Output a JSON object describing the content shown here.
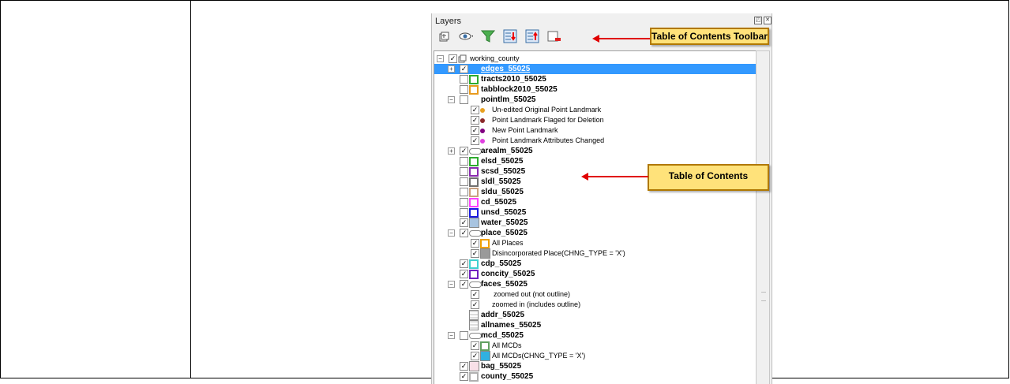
{
  "panel": {
    "title": "Layers"
  },
  "toolbar_icons": [
    "add-group-icon",
    "manage-visibility-icon",
    "filter-legend-icon",
    "expand-all-icon",
    "collapse-all-icon",
    "remove-layer-icon"
  ],
  "callouts": {
    "toolbar": "Table of Contents Toolbar",
    "toc": "Table of Contents"
  },
  "tree": [
    {
      "label": "working_county",
      "bold": false,
      "indent": 0,
      "checked": true,
      "expander": "-",
      "sym": "group"
    },
    {
      "label": "edges_55025",
      "bold": true,
      "indent": 1,
      "checked": true,
      "expander": "+",
      "sym": "none",
      "selected": true
    },
    {
      "label": "tracts2010_55025",
      "bold": true,
      "indent": 1,
      "checked": false,
      "sym": "sq",
      "color": "#2eab2e"
    },
    {
      "label": "tabblock2010_55025",
      "bold": true,
      "indent": 1,
      "checked": false,
      "sym": "sq",
      "color": "#e89a1e"
    },
    {
      "label": "pointlm_55025",
      "bold": true,
      "indent": 1,
      "checked": false,
      "expander": "-",
      "sym": "none"
    },
    {
      "label": "Un-edited Original Point Landmark",
      "bold": false,
      "indent": 2,
      "checked": true,
      "sym": "dot",
      "color": "#e8a020"
    },
    {
      "label": "Point Landmark Flaged for Deletion",
      "bold": false,
      "indent": 2,
      "checked": true,
      "sym": "dot",
      "color": "#8b2a2a"
    },
    {
      "label": "New Point Landmark",
      "bold": false,
      "indent": 2,
      "checked": true,
      "sym": "dot",
      "color": "#800080"
    },
    {
      "label": "Point Landmark Attributes Changed",
      "bold": false,
      "indent": 2,
      "checked": true,
      "sym": "dot",
      "color": "#e040e0"
    },
    {
      "label": "arealm_55025",
      "bold": true,
      "indent": 1,
      "checked": true,
      "expander": "+",
      "sym": "cloud"
    },
    {
      "label": "elsd_55025",
      "bold": true,
      "indent": 1,
      "checked": false,
      "sym": "sq",
      "color": "#2eab2e"
    },
    {
      "label": "scsd_55025",
      "bold": true,
      "indent": 1,
      "checked": false,
      "sym": "sq",
      "color": "#8a2ab0"
    },
    {
      "label": "sldl_55025",
      "bold": true,
      "indent": 1,
      "checked": false,
      "sym": "sq",
      "color": "#707070"
    },
    {
      "label": "sldu_55025",
      "bold": true,
      "indent": 1,
      "checked": false,
      "sym": "sq",
      "color": "#c8a080"
    },
    {
      "label": "cd_55025",
      "bold": true,
      "indent": 1,
      "checked": false,
      "sym": "sq",
      "color": "#ff40ff"
    },
    {
      "label": "unsd_55025",
      "bold": true,
      "indent": 1,
      "checked": false,
      "sym": "sq",
      "color": "#1a1ae0"
    },
    {
      "label": "water_55025",
      "bold": true,
      "indent": 1,
      "checked": true,
      "sym": "fill",
      "color": "#a8c4e0"
    },
    {
      "label": "place_55025",
      "bold": true,
      "indent": 1,
      "checked": true,
      "expander": "-",
      "sym": "cloud"
    },
    {
      "label": "All Places",
      "bold": false,
      "indent": 2,
      "checked": true,
      "sym": "sq",
      "color": "#f0a000"
    },
    {
      "label": "Disincorporated Place(CHNG_TYPE = 'X')",
      "bold": false,
      "indent": 2,
      "checked": true,
      "sym": "fill",
      "color": "#9a9a9a"
    },
    {
      "label": "cdp_55025",
      "bold": true,
      "indent": 1,
      "checked": true,
      "sym": "sq",
      "color": "#40d0d0"
    },
    {
      "label": "concity_55025",
      "bold": true,
      "indent": 1,
      "checked": true,
      "sym": "sq",
      "color": "#7020c0"
    },
    {
      "label": "faces_55025",
      "bold": true,
      "indent": 1,
      "checked": true,
      "expander": "-",
      "sym": "cloud"
    },
    {
      "label": "zoomed out (not outline)",
      "bold": false,
      "indent": 2,
      "checked": true,
      "sym": "none"
    },
    {
      "label": "zoomed in (includes outline)",
      "bold": false,
      "indent": 2,
      "checked": true,
      "sym": "blank"
    },
    {
      "label": "addr_55025",
      "bold": true,
      "indent": 1,
      "checked": null,
      "sym": "table"
    },
    {
      "label": "allnames_55025",
      "bold": true,
      "indent": 1,
      "checked": null,
      "sym": "table"
    },
    {
      "label": "mcd_55025",
      "bold": true,
      "indent": 1,
      "checked": false,
      "expander": "-",
      "sym": "cloud"
    },
    {
      "label": "All MCDs",
      "bold": false,
      "indent": 2,
      "checked": true,
      "sym": "sq",
      "color": "#60a060"
    },
    {
      "label": "All MCDs(CHNG_TYPE = 'X')",
      "bold": false,
      "indent": 2,
      "checked": true,
      "sym": "fill",
      "color": "#30b0e0"
    },
    {
      "label": "bag_55025",
      "bold": true,
      "indent": 1,
      "checked": true,
      "sym": "fill",
      "color": "#f8e0e8"
    },
    {
      "label": "county_55025",
      "bold": true,
      "indent": 1,
      "checked": true,
      "sym": "sq",
      "color": "#b0b0b0"
    }
  ]
}
